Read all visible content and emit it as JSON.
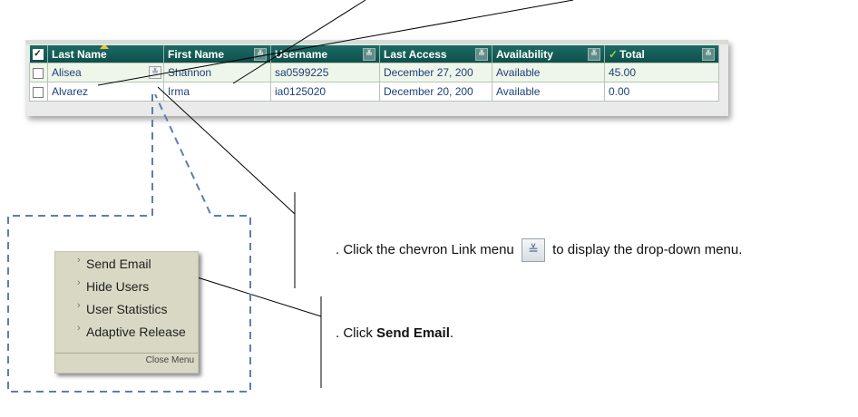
{
  "grid": {
    "columns": [
      {
        "label": "Last Name"
      },
      {
        "label": "First Name"
      },
      {
        "label": "Username"
      },
      {
        "label": "Last Access"
      },
      {
        "label": "Availability"
      },
      {
        "label": "Total"
      }
    ],
    "rows": [
      {
        "last": "Alisea",
        "first": "Shannon",
        "username": "sa0599225",
        "access": "December 27, 200",
        "availability": "Available",
        "total": "45.00"
      },
      {
        "last": "Alvarez",
        "first": "Irma",
        "username": "ia0125020",
        "access": "December 20, 200",
        "availability": "Available",
        "total": "0.00"
      }
    ]
  },
  "menu": {
    "items": [
      "Send Email",
      "Hide Users",
      "User Statistics",
      "Adaptive Release"
    ],
    "close_label": "Close Menu"
  },
  "instructions": {
    "step1_prefix": ". Click the chevron Link menu",
    "step1_suffix": "to display the drop-down menu.",
    "step2_prefix": ". Click ",
    "step2_bold": "Send Email",
    "step2_suffix": "."
  },
  "colors": {
    "header": "#0f4f4a",
    "row_highlight": "#eef5e9",
    "cell_text": "#1d3f7a",
    "callout_dash": "#5b7fb0",
    "menu_bg": "#d8d8c4"
  }
}
